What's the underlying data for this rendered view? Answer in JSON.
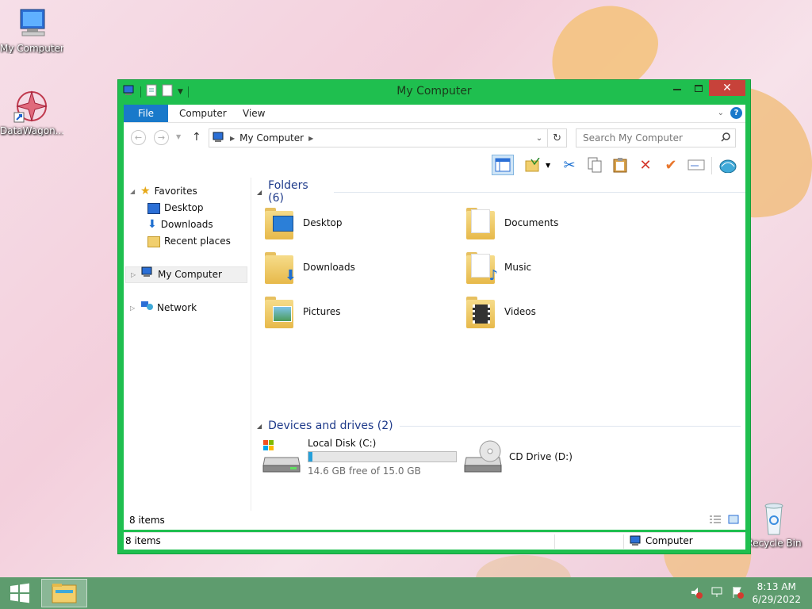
{
  "desktop": {
    "icons": [
      {
        "label": "My Computer"
      },
      {
        "label": "DataWagon..."
      },
      {
        "label": "Recycle Bin"
      }
    ]
  },
  "window": {
    "title": "My Computer",
    "ribbon": {
      "tabs": [
        "File",
        "Computer",
        "View"
      ]
    },
    "address": {
      "path": "My Computer",
      "search_placeholder": "Search My Computer"
    },
    "nav": {
      "favorites": "Favorites",
      "desktop": "Desktop",
      "downloads": "Downloads",
      "recent": "Recent places",
      "computer": "My Computer",
      "network": "Network"
    },
    "groups": {
      "folders": "Folders (6)",
      "devices": "Devices and drives (2)"
    },
    "folders": [
      {
        "name": "Desktop",
        "icon": "desktop-folder-icon"
      },
      {
        "name": "Documents",
        "icon": "documents-folder-icon"
      },
      {
        "name": "Downloads",
        "icon": "downloads-folder-icon"
      },
      {
        "name": "Music",
        "icon": "music-folder-icon"
      },
      {
        "name": "Pictures",
        "icon": "pictures-folder-icon"
      },
      {
        "name": "Videos",
        "icon": "videos-folder-icon"
      }
    ],
    "drives": [
      {
        "name": "Local Disk (C:)",
        "free": "14.6 GB free of 15.0 GB",
        "used_fraction": 0.027
      },
      {
        "name": "CD Drive (D:)"
      }
    ],
    "status_inner": "8 items",
    "status_outer_left": "8 items",
    "status_outer_right": "Computer"
  },
  "taskbar": {
    "time": "8:13 AM",
    "date": "6/29/2022"
  },
  "colors": {
    "window_frame": "#1fbf4f",
    "file_tab": "#1979ca",
    "close_button": "#c7423a",
    "taskbar": "#5e9c6e",
    "drive_bar_fill": "#26a0da"
  }
}
